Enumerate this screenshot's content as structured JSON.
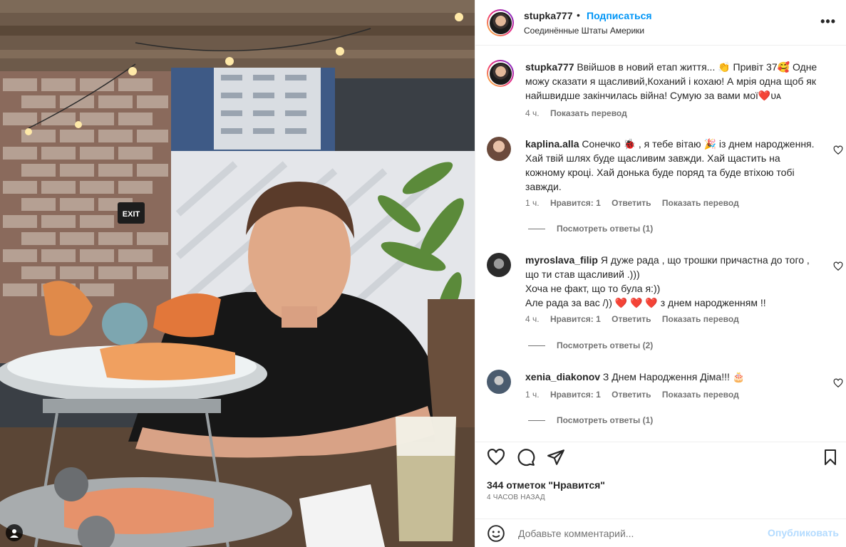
{
  "post": {
    "username": "stupka777",
    "dot": "•",
    "follow_label": "Подписаться",
    "location": "Соединённые Штаты Америки",
    "more_label": "•••"
  },
  "caption": {
    "username": "stupka777",
    "text": " Ввійшов в новий етап життя... 👏 Привіт 37🥰 Одне можу сказати я щасливий,Коханий і кохаю! А мрія одна щоб як найшвидше закінчилась війна! Сумую за вами мої❤️ᴜᴀ",
    "time": "4 ч.",
    "translate": "Показать перевод"
  },
  "comments": [
    {
      "username": "kaplina.alla",
      "text": " Сонечко 🐞 , я тебе вітаю 🎉 із днем народження. Хай твій шлях буде щасливим завжди. Хай щастить на кожному кроці. Хай донька буде поряд та буде втіхою тобі завжди.",
      "time": "1 ч.",
      "likes": "Нравится: 1",
      "reply": "Ответить",
      "translate": "Показать перевод",
      "view_replies": "Посмотреть ответы (1)",
      "avatar_color": "#b58c78"
    },
    {
      "username": "myroslava_filip",
      "text": " Я дуже рада , що трошки причастна до того , що ти став щасливий .)))",
      "line2": "Хоча не факт, що то була я:))",
      "line3": "Але рада за вас /)) ❤️ ❤️ ❤️  з днем народженням !!",
      "time": "4 ч.",
      "likes": "Нравится: 1",
      "reply": "Ответить",
      "translate": "Показать перевод",
      "view_replies": "Посмотреть ответы (2)",
      "avatar_color": "#2f2f2f"
    },
    {
      "username": "xenia_diakonov",
      "text": " З Днем Народження Діма!!! 🎂",
      "time": "1 ч.",
      "likes": "Нравится: 1",
      "reply": "Ответить",
      "translate": "Показать перевод",
      "view_replies": "Посмотреть ответы (1)",
      "avatar_color": "#4a5b6e"
    }
  ],
  "likes_text": "344 отметок \"Нравится\"",
  "time_ago": "4 ЧАСОВ НАЗАД",
  "add_comment": {
    "placeholder": "Добавьте комментарий...",
    "publish": "Опубликовать"
  },
  "icons": {
    "like": "heart-icon",
    "comment": "comment-bubble-icon",
    "share": "paper-plane-icon",
    "save": "bookmark-icon",
    "emoji": "smiley-icon",
    "user_tag": "user-tag-icon"
  },
  "colors": {
    "link_blue": "#0095f6",
    "publish_disabled": "#b3dbff",
    "secondary_text": "#737373",
    "border": "#efefef"
  }
}
